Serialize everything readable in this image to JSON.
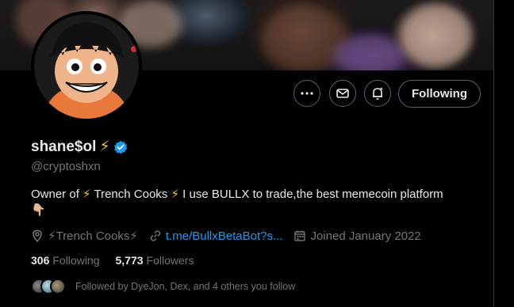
{
  "profile": {
    "name": "shane$ol",
    "name_emoji": "⚡",
    "handle": "@cryptoshxn",
    "bio_parts": [
      "Owner of ",
      "⚡",
      " Trench Cooks ",
      "⚡",
      " I use BULLX to trade,the best memecoin platform"
    ],
    "bio_emoji_line2": "👇🏼",
    "location": "⚡Trench Cooks⚡",
    "website": "t.me/BullxBetaBot?s...",
    "joined": "Joined January 2022"
  },
  "stats": {
    "following_count": "306",
    "following_label": "Following",
    "followers_count": "5,773",
    "followers_label": "Followers"
  },
  "followed_by": "Followed by DyeJon, Dex, and 4 others you follow",
  "actions": {
    "more_label": "…",
    "following_label": "Following"
  },
  "icons": [
    "more-icon",
    "mail-icon",
    "notification-bell-icon",
    "verified-badge-icon",
    "location-icon",
    "link-icon",
    "calendar-icon"
  ],
  "colors": {
    "accent": "#1d9bf0",
    "verified": "#1d9bf0",
    "muted": "#71767b",
    "text": "#e7e9ea",
    "bolt": "#f5c518"
  }
}
